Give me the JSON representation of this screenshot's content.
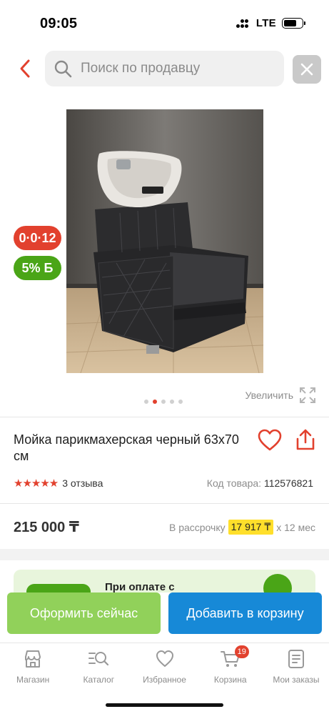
{
  "status_bar": {
    "time": "09:05",
    "network": "LTE",
    "battery_level": 0.7
  },
  "search": {
    "placeholder": "Поиск по продавцу"
  },
  "icons": {
    "back": "chevron-left-icon",
    "search": "search-icon",
    "close": "close-icon",
    "zoom": "expand-icon",
    "favorite": "heart-icon",
    "share": "share-icon"
  },
  "badges": {
    "installment": "0·0·12",
    "bonus": "5% Б"
  },
  "gallery": {
    "image_count": 5,
    "active_index": 1,
    "zoom_label": "Увеличить"
  },
  "product": {
    "title": "Мойка парикмахерская черный 63х70 см",
    "rating": 5,
    "stars": "★★★★★",
    "reviews": "3 отзыва",
    "sku_label": "Код товара:",
    "sku_value": "112576821",
    "price": "215 000 ₸",
    "installment_prefix": "В рассрочку",
    "installment_amount": "17 917 ₸",
    "installment_suffix": "х 12 мес"
  },
  "promo": {
    "text": "При оплате с"
  },
  "actions": {
    "order_now": "Оформить сейчас",
    "add_to_cart": "Добавить в корзину"
  },
  "tabs": [
    {
      "label": "Магазин",
      "icon": "shop-icon"
    },
    {
      "label": "Каталог",
      "icon": "catalog-search-icon"
    },
    {
      "label": "Избранное",
      "icon": "heart-icon"
    },
    {
      "label": "Корзина",
      "icon": "cart-icon",
      "badge": "19"
    },
    {
      "label": "Мои заказы",
      "icon": "orders-icon"
    }
  ],
  "colors": {
    "accent_red": "#e2412e",
    "bonus_green": "#4aa517",
    "order_button": "#91d15a",
    "cart_button": "#1789d7",
    "installment_highlight": "#ffdf2b"
  }
}
